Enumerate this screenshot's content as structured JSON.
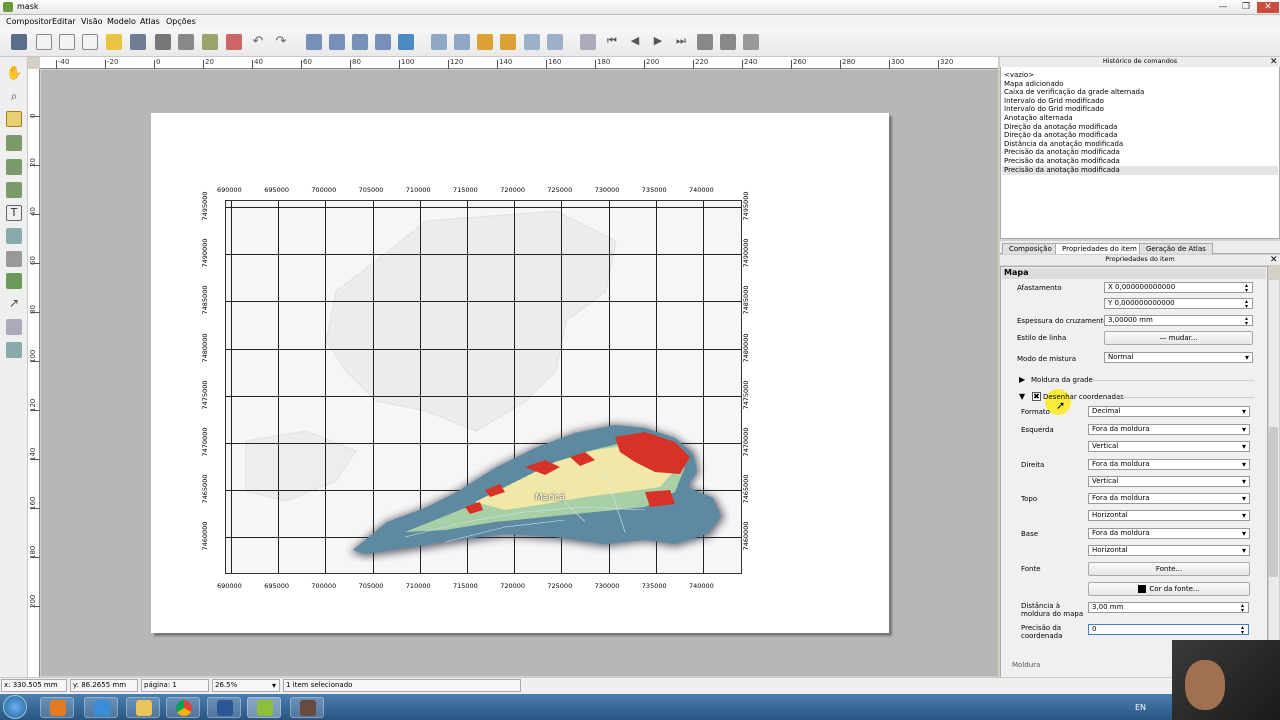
{
  "window": {
    "title": "mask",
    "minimize": "—",
    "maximize": "❐",
    "close": "✕"
  },
  "menu": [
    "Compositor",
    "Editar",
    "Visão",
    "Modelo",
    "Atlas",
    "Opções"
  ],
  "ruler_h": [
    "-40",
    "-20",
    "0",
    "20",
    "40",
    "60",
    "80",
    "100",
    "120",
    "140",
    "160",
    "180",
    "200",
    "220",
    "240",
    "260",
    "280",
    "300",
    "320"
  ],
  "ruler_v": [
    "0",
    "20",
    "40",
    "60",
    "80",
    "100",
    "120",
    "140",
    "160",
    "180",
    "200"
  ],
  "map": {
    "x_coords": [
      "690000",
      "695000",
      "700000",
      "705000",
      "710000",
      "715000",
      "720000",
      "725000",
      "730000",
      "735000",
      "740000"
    ],
    "y_coords": [
      "7495000",
      "7490000",
      "7485000",
      "7480000",
      "7475000",
      "7470000",
      "7465000",
      "7460000"
    ],
    "place_label": "Maricá"
  },
  "history": {
    "title": "Histórico de comandos",
    "items": [
      "<vazio>",
      "Mapa adicionado",
      "Caixa de verificação da grade alternada",
      "Intervalo do Grid modificado",
      "Intervalo do Grid modificado",
      "Anotação alternada",
      "Direção da anotação modificada",
      "Direção da anotação modificada",
      "Distância da anotação modificada",
      "Precisão da anotação modificada",
      "Precisão da anotação modificada",
      "Precisão da anotação modificada"
    ]
  },
  "tabs": [
    "Composição",
    "Propriedades do item",
    "Geração de Atlas"
  ],
  "props": {
    "header": "Propriedades do item",
    "section": "Mapa",
    "afastamento_label": "Afastamento",
    "afastamento_x": "X 0,000000000000",
    "afastamento_y": "Y 0,000000000000",
    "espessura_label": "Espessura do cruzamento",
    "espessura_value": "3,00000 mm",
    "estilo_label": "Estilo de linha",
    "estilo_button": "— mudar...",
    "mistura_label": "Modo de mistura",
    "mistura_value": "Normal",
    "moldura_label": "Moldura da grade",
    "desenhar_label": "Desenhar coordenadas",
    "formato_label": "Formato",
    "formato_value": "Decimal",
    "esquerda_label": "Esquerda",
    "esquerda_pos": "Fora da moldura",
    "esquerda_dir": "Vertical",
    "direita_label": "Direita",
    "direita_pos": "Fora da moldura",
    "direita_dir": "Vertical",
    "topo_label": "Topo",
    "topo_pos": "Fora da moldura",
    "topo_dir": "Horizontal",
    "base_label": "Base",
    "base_pos": "Fora da moldura",
    "base_dir": "Horizontal",
    "fonte_label": "Fonte",
    "fonte_button": "Fonte...",
    "cor_fonte_button": "Cor da fonte...",
    "distancia_label": "Distância à moldura do mapa",
    "distancia_value": "3,00 mm",
    "precisao_label": "Precisão da coordenada",
    "precisao_value": "0",
    "next_section": "Moldura"
  },
  "status": {
    "x": "x: 330.505 mm",
    "y": "y: 86.2655 mm",
    "page": "página: 1",
    "zoom": "26.5%",
    "selection": "1 item selecionado"
  },
  "taskbar": {
    "lang": "EN"
  }
}
